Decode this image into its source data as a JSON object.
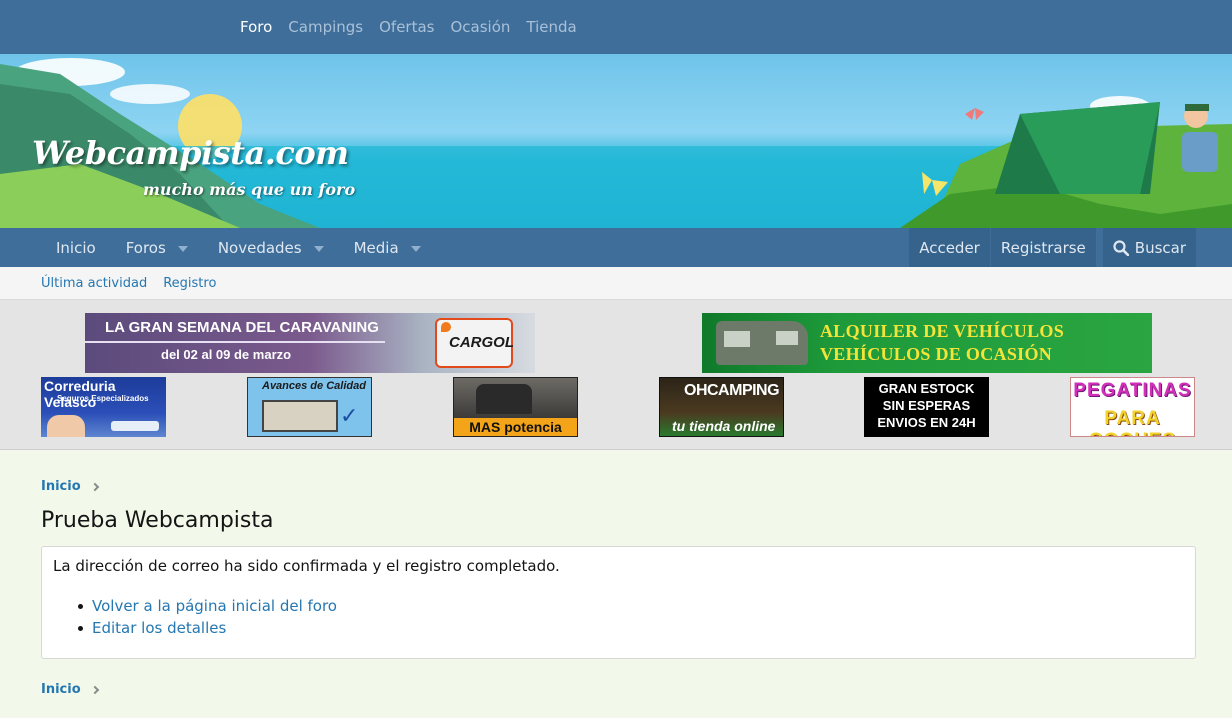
{
  "topnav": {
    "items": [
      "Foro",
      "Campings",
      "Ofertas",
      "Ocasión",
      "Tienda"
    ],
    "active": "Foro"
  },
  "banner": {
    "title": "Webcampista.com",
    "subtitle": "mucho más que un foro"
  },
  "mainnav": {
    "tabs": [
      {
        "label": "Inicio"
      },
      {
        "label": "Foros"
      },
      {
        "label": "Novedades"
      },
      {
        "label": "Media"
      }
    ],
    "login": "Acceder",
    "register": "Registrarse",
    "search": "Buscar"
  },
  "subnav": {
    "items": [
      "Última actividad",
      "Registro"
    ]
  },
  "ads": {
    "caravaning": {
      "line1": "LA GRAN SEMANA DEL CARAVANING",
      "line2": "del 02 al 09 de marzo",
      "brand": "CARGOL"
    },
    "alquiler": {
      "line1": "ALQUILER DE VEHÍCULOS",
      "line2": "VEHÍCULOS DE OCASIÓN"
    },
    "velasco": {
      "line1": "Correduria Velasco",
      "line2": "Seguros Especializados"
    },
    "avances": {
      "line1": "Avances de Calidad"
    },
    "potencia": {
      "line1": "MAS potencia"
    },
    "ohcamping": {
      "line1": "OHCAMPING",
      "line2": "tu tienda online"
    },
    "estock": {
      "line1": "GRAN ESTOCK",
      "line2": "SIN ESPERAS",
      "line3": "ENVIOS EN 24H"
    },
    "pegatinas": {
      "line1": "PEGATINAS",
      "line2": "PARA COCHES"
    }
  },
  "breadcrumb": {
    "label": "Inicio"
  },
  "page": {
    "title": "Prueba Webcampista",
    "message": "La dirección de correo ha sido confirmada y el registro completado.",
    "links": [
      "Volver a la página inicial del foro",
      "Editar los detalles"
    ]
  },
  "colors": {
    "nav": "#3e6e99",
    "link": "#2577b1",
    "background": "#f2f8ea"
  }
}
